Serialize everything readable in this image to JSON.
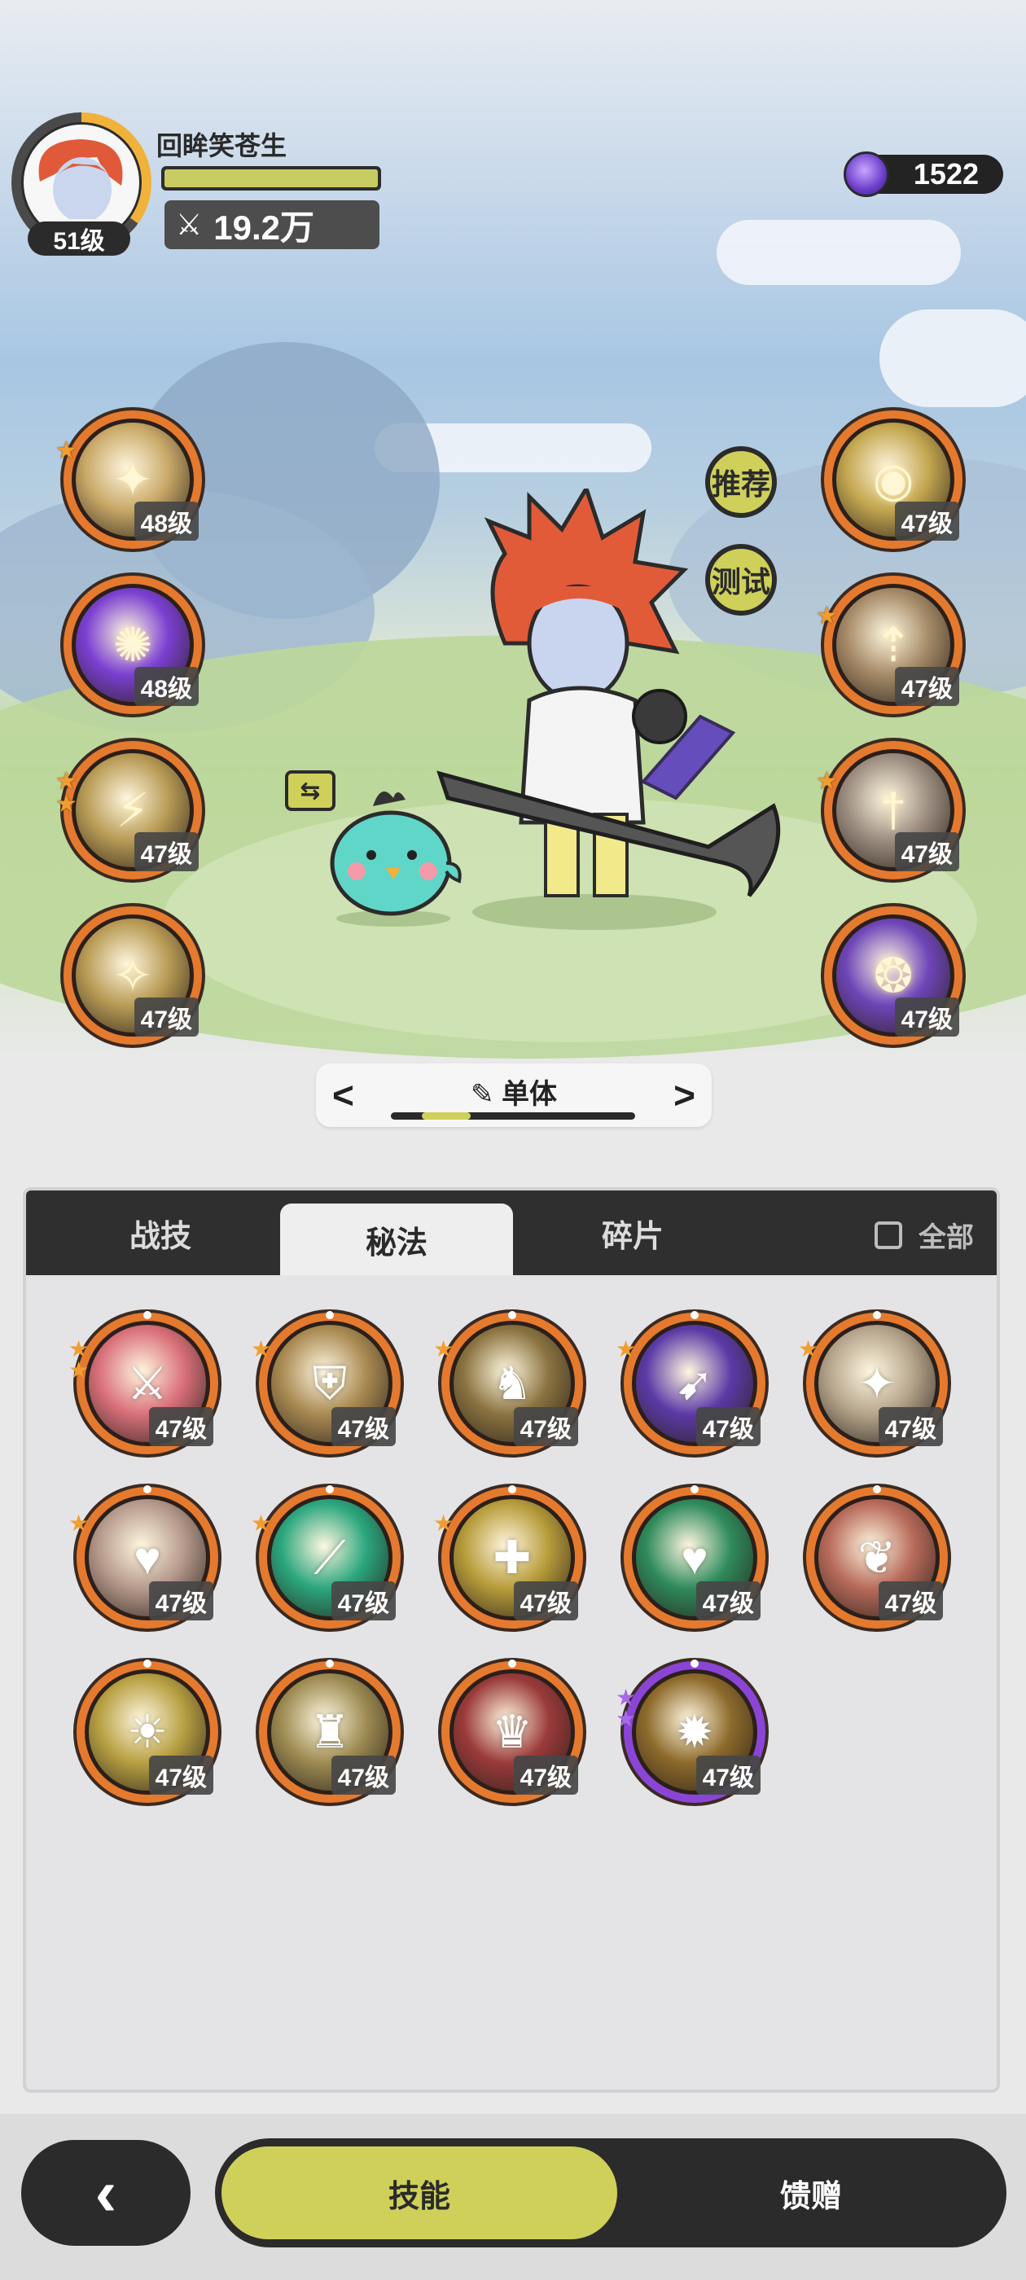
{
  "player": {
    "name": "回眸笑苍生",
    "level": "51级",
    "power": "19.2万",
    "power_icon": "crossed-swords-icon",
    "hp_fraction": 1.0
  },
  "currency": {
    "icon": "purple-gem-icon",
    "amount": "1522"
  },
  "buttons": {
    "recommend": "推荐",
    "test": "测试"
  },
  "left_skills": [
    {
      "level": "48级",
      "stars": 1,
      "icon": "slash-strike-icon",
      "color": "#c9a968"
    },
    {
      "level": "48级",
      "stars": 0,
      "icon": "purple-flame-icon",
      "color": "#7a3fd1"
    },
    {
      "level": "47级",
      "stars": 2,
      "icon": "blade-burst-icon",
      "color": "#b89b55"
    },
    {
      "level": "47级",
      "stars": 0,
      "icon": "sword-sparkle-icon",
      "color": "#b89b55"
    }
  ],
  "right_skills": [
    {
      "level": "47级",
      "stars": 0,
      "icon": "eye-icon",
      "color": "#c3a64f"
    },
    {
      "level": "47级",
      "stars": 1,
      "icon": "sword-up-icon",
      "color": "#a58a67"
    },
    {
      "level": "47级",
      "stars": 1,
      "icon": "dagger-icon",
      "color": "#9c8d80"
    },
    {
      "level": "47级",
      "stars": 0,
      "icon": "purple-orb-icon",
      "color": "#6e45b8"
    }
  ],
  "mode_selector": {
    "label": "单体",
    "edit_icon": "pencil-icon",
    "prev": "<",
    "next": ">"
  },
  "tabs": [
    {
      "label": "战技",
      "active": false
    },
    {
      "label": "秘法",
      "active": true
    },
    {
      "label": "碎片",
      "active": false
    }
  ],
  "all_toggle": {
    "label": "全部",
    "checked": false
  },
  "grid_skills": [
    {
      "level": "47级",
      "stars": 2,
      "icon": "red-sword-icon",
      "color": "#d9707a",
      "rarity": "orange"
    },
    {
      "level": "47级",
      "stars": 1,
      "icon": "armor-icon",
      "color": "#a98a52",
      "rarity": "orange"
    },
    {
      "level": "47级",
      "stars": 1,
      "icon": "horn-icon",
      "color": "#8a7340",
      "rarity": "orange"
    },
    {
      "level": "47级",
      "stars": 1,
      "icon": "purple-cloak-icon",
      "color": "#5b3aa6",
      "rarity": "orange"
    },
    {
      "level": "47级",
      "stars": 1,
      "icon": "light-blade-icon",
      "color": "#b5a48b",
      "rarity": "orange"
    },
    {
      "level": "47级",
      "stars": 1,
      "icon": "heart-shield-icon",
      "color": "#b69a8c",
      "rarity": "orange"
    },
    {
      "level": "47级",
      "stars": 1,
      "icon": "green-blade-icon",
      "color": "#2aa67d",
      "rarity": "orange"
    },
    {
      "level": "47级",
      "stars": 1,
      "icon": "heal-figure-icon",
      "color": "#b79c3a",
      "rarity": "orange"
    },
    {
      "level": "47级",
      "stars": 0,
      "icon": "green-heart-icon",
      "color": "#2e8a5c",
      "rarity": "orange"
    },
    {
      "level": "47级",
      "stars": 0,
      "icon": "red-wing-icon",
      "color": "#b76a5a",
      "rarity": "orange"
    },
    {
      "level": "47级",
      "stars": 0,
      "icon": "golden-spirit-icon",
      "color": "#b7a042",
      "rarity": "orange"
    },
    {
      "level": "47级",
      "stars": 0,
      "icon": "golem-icon",
      "color": "#9d8b52",
      "rarity": "orange"
    },
    {
      "level": "47级",
      "stars": 0,
      "icon": "red-knight-icon",
      "color": "#9a3a3a",
      "rarity": "orange"
    },
    {
      "level": "47级",
      "stars": 2,
      "icon": "golden-vortex-icon",
      "color": "#8d6a2b",
      "rarity": "purple"
    }
  ],
  "bottom_nav": {
    "back_icon": "chevron-left-icon",
    "skills": "技能",
    "gift": "馈赠"
  }
}
